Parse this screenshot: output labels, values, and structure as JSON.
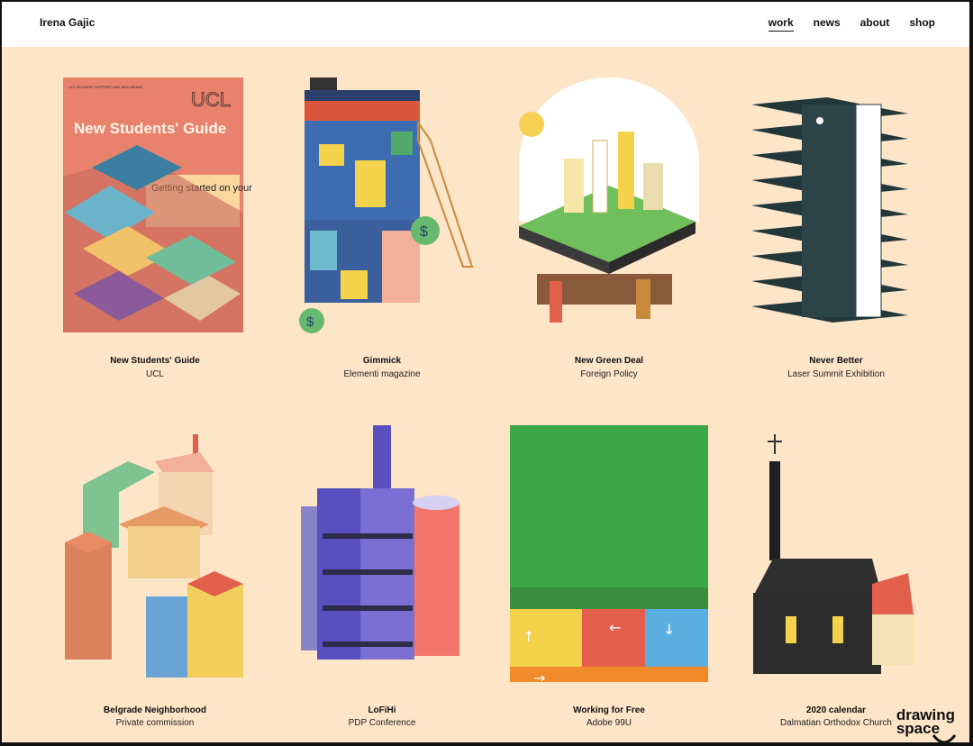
{
  "header": {
    "brand": "Irena Gajic",
    "nav": [
      {
        "label": "work",
        "active": true
      },
      {
        "label": "news",
        "active": false
      },
      {
        "label": "about",
        "active": false
      },
      {
        "label": "shop",
        "active": false
      }
    ]
  },
  "projects": [
    {
      "title": "New Students' Guide",
      "client": "UCL",
      "cover": {
        "org_line": "UCL STUDENT SUPPORT AND WELLBEING",
        "logo": "UCL",
        "headline": "New Students' Guide",
        "subhead": "Getting started on your UCL journey"
      }
    },
    {
      "title": "Gimmick",
      "client": "Elementi magazine"
    },
    {
      "title": "New Green Deal",
      "client": "Foreign Policy"
    },
    {
      "title": "Never Better",
      "client": "Laser Summit Exhibition"
    },
    {
      "title": "Belgrade Neighborhood",
      "client": "Private commission"
    },
    {
      "title": "LoFiHi",
      "client": "PDP Conference"
    },
    {
      "title": "Working for Free",
      "client": "Adobe 99U"
    },
    {
      "title": "2020 calendar",
      "client": "Dalmatian Orthodox Church"
    }
  ],
  "watermark": {
    "line1": "drawing",
    "line2": "space"
  },
  "colors": {
    "background": "#fde5c8",
    "header": "#ffffff",
    "text": "#111111"
  },
  "icons": [
    "dollar-icon",
    "arrow-icon",
    "smile-icon"
  ]
}
